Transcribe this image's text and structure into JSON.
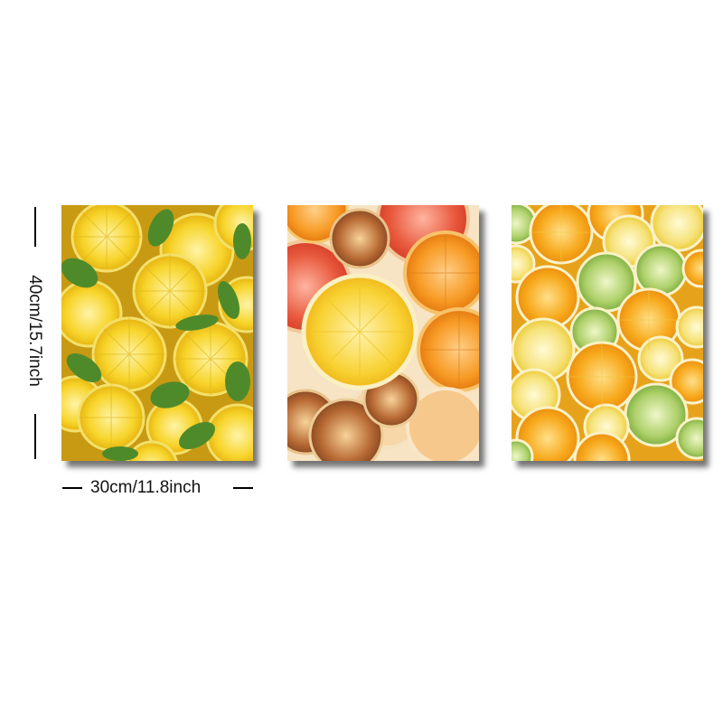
{
  "dimensions": {
    "height_label": "40cm/15.7inch",
    "width_label": "30cm/11.8inch"
  },
  "colors": {
    "background": "#ffffff",
    "lemon": "#f5cc1f",
    "orange": "#f49a1a",
    "grapefruit": "#e8523a",
    "lime": "#a9cf6a",
    "leaf": "#4f8a2a"
  }
}
